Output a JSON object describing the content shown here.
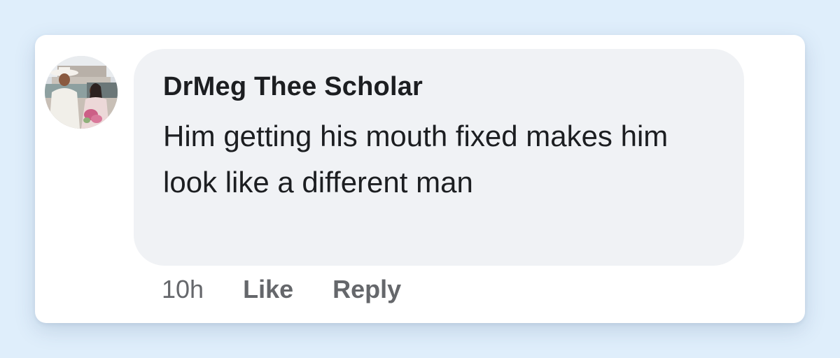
{
  "comment": {
    "author": "DrMeg Thee Scholar",
    "text": "Him getting his mouth fixed makes him look like a different man",
    "timestamp": "10h",
    "like_label": "Like",
    "reply_label": "Reply"
  },
  "colors": {
    "page_background": "#dfeefb",
    "card_background": "#ffffff",
    "bubble_background": "#f0f2f5",
    "text_primary": "#1c1e21",
    "text_secondary": "#65676b"
  }
}
